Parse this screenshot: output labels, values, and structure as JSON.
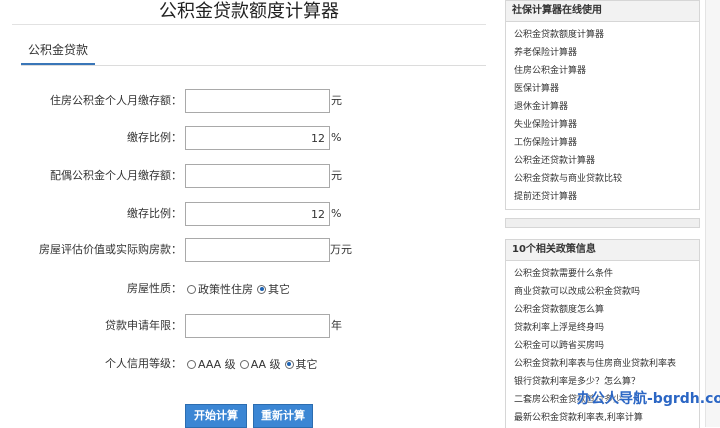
{
  "page": {
    "title": "公积金贷款额度计算器"
  },
  "tab": {
    "label": "公积金贷款"
  },
  "form": {
    "fields": [
      {
        "label": "住房公积金个人月缴存额：",
        "value": "",
        "unit": "元"
      },
      {
        "label": "缴存比例：",
        "value": "12",
        "unit": "%"
      },
      {
        "label": "配偶公积金个人月缴存额：",
        "value": "",
        "unit": "元"
      },
      {
        "label": "缴存比例：",
        "value": "12",
        "unit": "%"
      },
      {
        "label": "房屋评估价值或实际购房款：",
        "value": "",
        "unit": "万元"
      }
    ],
    "house_type": {
      "label": "房屋性质：",
      "options": [
        "政策性住房",
        "其它"
      ],
      "selected": "其它"
    },
    "years": {
      "label": "贷款申请年限：",
      "value": "",
      "unit": "年"
    },
    "credit": {
      "label": "个人信用等级：",
      "options": [
        "AAA 级",
        "AA 级",
        "其它"
      ],
      "selected": "其它"
    },
    "buttons": {
      "calculate": "开始计算",
      "reset": "重新计算"
    }
  },
  "sidebar": {
    "online": {
      "title": "社保计算器在线使用",
      "items": [
        "公积金贷款额度计算器",
        "养老保险计算器",
        "住房公积金计算器",
        "医保计算器",
        "退休金计算器",
        "失业保险计算器",
        "工伤保险计算器",
        "公积金还贷款计算器",
        "公积金贷款与商业贷款比较",
        "提前还贷计算器"
      ]
    },
    "policy": {
      "title": "10个相关政策信息",
      "items": [
        "公积金贷款需要什么条件",
        "商业贷款可以改成公积金贷款吗",
        "公积金贷款额度怎么算",
        "贷款利率上浮是终身吗",
        "公积金可以跨省买房吗",
        "公积金贷款利率表与住房商业贷款利率表",
        "银行贷款利率是多少？怎么算？",
        "二套房公积金贷款首付多少",
        "最新公积金贷款利率表,利率计算"
      ]
    }
  },
  "watermark": {
    "text": "办公人导航-bgrdh.com"
  }
}
